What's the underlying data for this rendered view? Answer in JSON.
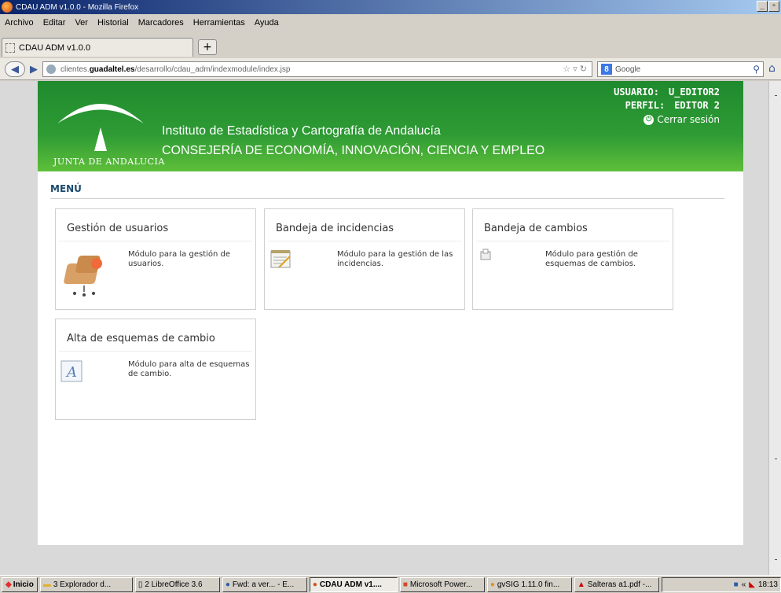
{
  "window": {
    "title": "CDAU ADM v1.0.0 - Mozilla Firefox"
  },
  "menubar": {
    "items": [
      "Archivo",
      "Editar",
      "Ver",
      "Historial",
      "Marcadores",
      "Herramientas",
      "Ayuda"
    ]
  },
  "tab": {
    "label": "CDAU ADM v1.0.0",
    "new_tab": "+"
  },
  "nav": {
    "url_prefix": "clientes.",
    "url_domain": "guadaltel.es",
    "url_path": "/desarrollo/cdau_adm/indexmodule/index.jsp",
    "search_placeholder": "Google"
  },
  "header": {
    "logo_text": "JUNTA DE ANDALUCIA",
    "institute": "Instituto de Estadística y Cartografía de Andalucía",
    "consejeria": "CONSEJERÍA DE ECONOMÍA, INNOVACIÓN, CIENCIA Y EMPLEO",
    "user_label": "USUARIO:",
    "user_value": "U_EDITOR2",
    "profile_label": "PERFIL:",
    "profile_value": "EDITOR 2",
    "logout": "Cerrar sesión"
  },
  "menu": {
    "title": "MENÚ",
    "cards": [
      {
        "title": "Gestión de usuarios",
        "desc": "Módulo para la gestión de usuarios.",
        "icon": "chair-icon"
      },
      {
        "title": "Bandeja de incidencias",
        "desc": "Módulo para la gestión de las incidencias.",
        "icon": "notepad-icon"
      },
      {
        "title": "Bandeja de cambios",
        "desc": "Módulo para gestión de esquemas de cambios.",
        "icon": "document-icon"
      },
      {
        "title": "Alta de esquemas de cambio",
        "desc": "Módulo para alta de esquemas de cambio.",
        "icon": "font-icon"
      }
    ]
  },
  "taskbar": {
    "start": "Inicio",
    "items": [
      "3 Explorador d...",
      "2 LibreOffice 3.6",
      "Fwd: a ver... - E...",
      "CDAU ADM v1....",
      "Microsoft Power...",
      "gvSIG 1.11.0 fin...",
      "Salteras a1.pdf -..."
    ],
    "clock": "18:13"
  }
}
